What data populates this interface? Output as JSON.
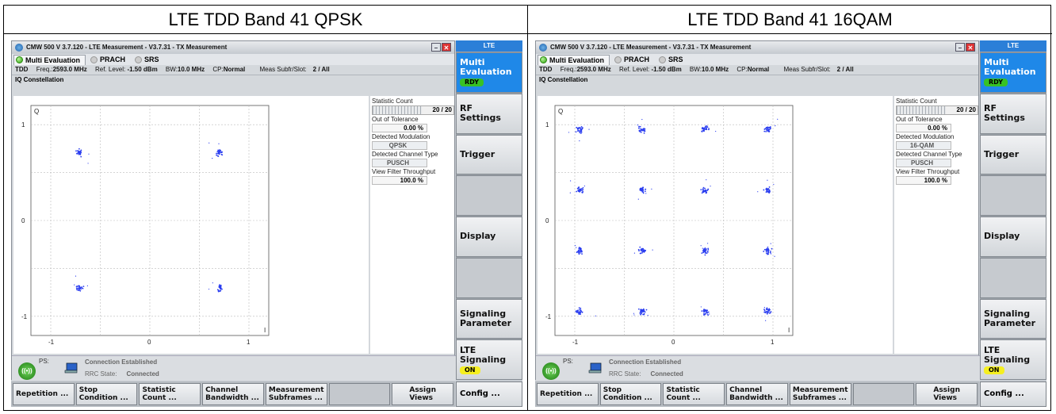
{
  "panels": [
    {
      "caption": "LTE TDD Band 41 QPSK",
      "window_title": "CMW 500 V 3.7.120 - LTE Measurement - V3.7.31 - TX Measurement",
      "tabs": [
        "Multi Evaluation",
        "PRACH",
        "SRS"
      ],
      "info": {
        "mode": "TDD",
        "freq_label": "Freq.:",
        "freq_value": "2593.0 MHz",
        "ref_label": "Ref. Level:",
        "ref_value": "-1.50 dBm",
        "bw_label": "BW:",
        "bw_value": "10.0 MHz",
        "cp_label": "CP:",
        "cp_value": "Normal",
        "subfr_label": "Meas Subfr/Slot:",
        "subfr_value": "2 / All"
      },
      "section_title": "IQ Constellation",
      "plot": {
        "axis_q": "Q",
        "axis_i": "I",
        "y_ticks": [
          "1",
          "0",
          "-1"
        ],
        "x_ticks": [
          "-1",
          "0",
          "1"
        ],
        "modulation": "QPSK"
      },
      "stats": {
        "statistic_count_label": "Statistic Count",
        "statistic_count_value": "20 / 20",
        "out_of_tolerance_label": "Out of Tolerance",
        "out_of_tolerance_value": "0.00  %",
        "detected_modulation_label": "Detected Modulation",
        "detected_modulation_value": "QPSK",
        "detected_channel_type_label": "Detected Channel Type",
        "detected_channel_type_value": "PUSCH",
        "view_filter_label": "View Filter Throughput",
        "view_filter_value": "100.0  %"
      },
      "status": {
        "ps_label": "PS:",
        "connection": "Connection Established",
        "rrc_label": "RRC State:",
        "rrc_value": "Connected"
      },
      "softkeys": [
        "Repetition ...",
        "Stop\nCondition ...",
        "Statistic\nCount ...",
        "Channel\nBandwidth ...",
        "Measurement\nSubframes ...",
        "",
        "Assign\nViews"
      ],
      "sidebar": {
        "title": "LTE",
        "items": [
          "Multi\nEvaluation",
          "RF\nSettings",
          "Trigger",
          "",
          "Display",
          "",
          "Signaling\nParameter",
          "LTE\nSignaling"
        ],
        "rdy_badge": "RDY",
        "on_badge": "ON",
        "config": "Config ..."
      }
    },
    {
      "caption": "LTE TDD Band 41 16QAM",
      "window_title": "CMW 500 V 3.7.120 - LTE Measurement - V3.7.31 - TX Measurement",
      "tabs": [
        "Multi Evaluation",
        "PRACH",
        "SRS"
      ],
      "info": {
        "mode": "TDD",
        "freq_label": "Freq.:",
        "freq_value": "2593.0 MHz",
        "ref_label": "Ref. Level:",
        "ref_value": "-1.50 dBm",
        "bw_label": "BW:",
        "bw_value": "10.0 MHz",
        "cp_label": "CP:",
        "cp_value": "Normal",
        "subfr_label": "Meas Subfr/Slot:",
        "subfr_value": "2 / All"
      },
      "section_title": "IQ Constellation",
      "plot": {
        "axis_q": "Q",
        "axis_i": "I",
        "y_ticks": [
          "1",
          "0",
          "-1"
        ],
        "x_ticks": [
          "-1",
          "0",
          "1"
        ],
        "modulation": "16QAM"
      },
      "stats": {
        "statistic_count_label": "Statistic Count",
        "statistic_count_value": "20 / 20",
        "out_of_tolerance_label": "Out of Tolerance",
        "out_of_tolerance_value": "0.00  %",
        "detected_modulation_label": "Detected Modulation",
        "detected_modulation_value": "16-QAM",
        "detected_channel_type_label": "Detected Channel Type",
        "detected_channel_type_value": "PUSCH",
        "view_filter_label": "View Filter Throughput",
        "view_filter_value": "100.0  %"
      },
      "status": {
        "ps_label": "PS:",
        "connection": "Connection Established",
        "rrc_label": "RRC State:",
        "rrc_value": "Connected"
      },
      "softkeys": [
        "Repetition ...",
        "Stop\nCondition ...",
        "Statistic\nCount ...",
        "Channel\nBandwidth ...",
        "Measurement\nSubframes ...",
        "",
        "Assign\nViews"
      ],
      "sidebar": {
        "title": "LTE",
        "items": [
          "Multi\nEvaluation",
          "RF\nSettings",
          "Trigger",
          "",
          "Display",
          "",
          "Signaling\nParameter",
          "LTE\nSignaling"
        ],
        "rdy_badge": "RDY",
        "on_badge": "ON",
        "config": "Config ..."
      }
    }
  ],
  "colors": {
    "accent_blue": "#1f88e8",
    "ready_green": "#38c224",
    "on_yellow": "#f5ef20",
    "constellation_points": "#2a3df0"
  }
}
